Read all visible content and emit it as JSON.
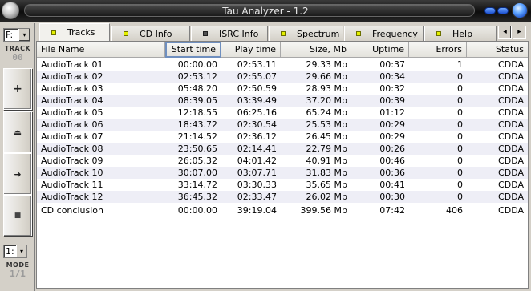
{
  "window": {
    "title": "Tau Analyzer - 1.2"
  },
  "left_panel": {
    "drive_value": "F:",
    "track_label": "TRACK",
    "track_digits": "00",
    "mode_value": "1:",
    "mode_label": "MODE",
    "mode_digits": "1/1",
    "buttons": [
      {
        "name": "add",
        "glyph": "+"
      },
      {
        "name": "eject",
        "glyph": "⏏"
      },
      {
        "name": "play",
        "glyph": "➜"
      },
      {
        "name": "stop",
        "glyph": "■"
      }
    ]
  },
  "tabs": [
    {
      "label": "Tracks",
      "active": true,
      "led": "on"
    },
    {
      "label": "CD Info",
      "active": false,
      "led": "on"
    },
    {
      "label": "ISRC Info",
      "active": false,
      "led": "off"
    },
    {
      "label": "Spectrum",
      "active": false,
      "led": "on"
    },
    {
      "label": "Frequency",
      "active": false,
      "led": "on"
    },
    {
      "label": "Help",
      "active": false,
      "led": "on"
    }
  ],
  "table": {
    "columns": [
      "File Name",
      "Start time",
      "Play time",
      "Size, Mb",
      "Uptime",
      "Errors",
      "Status"
    ],
    "rows": [
      [
        "AudioTrack 01",
        "00:00.00",
        "02:53.11",
        "29.33 Mb",
        "00:37",
        "1",
        "CDDA"
      ],
      [
        "AudioTrack 02",
        "02:53.12",
        "02:55.07",
        "29.66 Mb",
        "00:34",
        "0",
        "CDDA"
      ],
      [
        "AudioTrack 03",
        "05:48.20",
        "02:50.59",
        "28.93 Mb",
        "00:32",
        "0",
        "CDDA"
      ],
      [
        "AudioTrack 04",
        "08:39.05",
        "03:39.49",
        "37.20 Mb",
        "00:39",
        "0",
        "CDDA"
      ],
      [
        "AudioTrack 05",
        "12:18.55",
        "06:25.16",
        "65.24 Mb",
        "01:12",
        "0",
        "CDDA"
      ],
      [
        "AudioTrack 06",
        "18:43.72",
        "02:30.54",
        "25.53 Mb",
        "00:29",
        "0",
        "CDDA"
      ],
      [
        "AudioTrack 07",
        "21:14.52",
        "02:36.12",
        "26.45 Mb",
        "00:29",
        "0",
        "CDDA"
      ],
      [
        "AudioTrack 08",
        "23:50.65",
        "02:14.41",
        "22.79 Mb",
        "00:26",
        "0",
        "CDDA"
      ],
      [
        "AudioTrack 09",
        "26:05.32",
        "04:01.42",
        "40.91 Mb",
        "00:46",
        "0",
        "CDDA"
      ],
      [
        "AudioTrack 10",
        "30:07.00",
        "03:07.71",
        "31.83 Mb",
        "00:36",
        "0",
        "CDDA"
      ],
      [
        "AudioTrack 11",
        "33:14.72",
        "03:30.33",
        "35.65 Mb",
        "00:41",
        "0",
        "CDDA"
      ],
      [
        "AudioTrack 12",
        "36:45.32",
        "02:33.47",
        "26.02 Mb",
        "00:30",
        "0",
        "CDDA"
      ]
    ],
    "summary": [
      "CD conclusion",
      "00:00.00",
      "39:19.04",
      "399.56 Mb",
      "07:42",
      "406",
      "CDDA"
    ]
  }
}
